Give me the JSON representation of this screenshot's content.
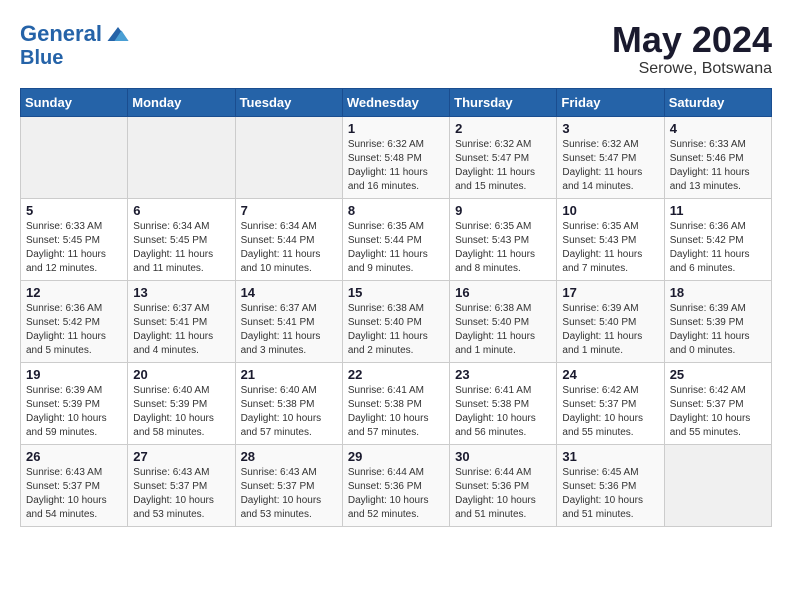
{
  "header": {
    "logo_line1": "General",
    "logo_line2": "Blue",
    "month": "May 2024",
    "location": "Serowe, Botswana"
  },
  "weekdays": [
    "Sunday",
    "Monday",
    "Tuesday",
    "Wednesday",
    "Thursday",
    "Friday",
    "Saturday"
  ],
  "weeks": [
    [
      {
        "day": "",
        "info": ""
      },
      {
        "day": "",
        "info": ""
      },
      {
        "day": "",
        "info": ""
      },
      {
        "day": "1",
        "info": "Sunrise: 6:32 AM\nSunset: 5:48 PM\nDaylight: 11 hours\nand 16 minutes."
      },
      {
        "day": "2",
        "info": "Sunrise: 6:32 AM\nSunset: 5:47 PM\nDaylight: 11 hours\nand 15 minutes."
      },
      {
        "day": "3",
        "info": "Sunrise: 6:32 AM\nSunset: 5:47 PM\nDaylight: 11 hours\nand 14 minutes."
      },
      {
        "day": "4",
        "info": "Sunrise: 6:33 AM\nSunset: 5:46 PM\nDaylight: 11 hours\nand 13 minutes."
      }
    ],
    [
      {
        "day": "5",
        "info": "Sunrise: 6:33 AM\nSunset: 5:45 PM\nDaylight: 11 hours\nand 12 minutes."
      },
      {
        "day": "6",
        "info": "Sunrise: 6:34 AM\nSunset: 5:45 PM\nDaylight: 11 hours\nand 11 minutes."
      },
      {
        "day": "7",
        "info": "Sunrise: 6:34 AM\nSunset: 5:44 PM\nDaylight: 11 hours\nand 10 minutes."
      },
      {
        "day": "8",
        "info": "Sunrise: 6:35 AM\nSunset: 5:44 PM\nDaylight: 11 hours\nand 9 minutes."
      },
      {
        "day": "9",
        "info": "Sunrise: 6:35 AM\nSunset: 5:43 PM\nDaylight: 11 hours\nand 8 minutes."
      },
      {
        "day": "10",
        "info": "Sunrise: 6:35 AM\nSunset: 5:43 PM\nDaylight: 11 hours\nand 7 minutes."
      },
      {
        "day": "11",
        "info": "Sunrise: 6:36 AM\nSunset: 5:42 PM\nDaylight: 11 hours\nand 6 minutes."
      }
    ],
    [
      {
        "day": "12",
        "info": "Sunrise: 6:36 AM\nSunset: 5:42 PM\nDaylight: 11 hours\nand 5 minutes."
      },
      {
        "day": "13",
        "info": "Sunrise: 6:37 AM\nSunset: 5:41 PM\nDaylight: 11 hours\nand 4 minutes."
      },
      {
        "day": "14",
        "info": "Sunrise: 6:37 AM\nSunset: 5:41 PM\nDaylight: 11 hours\nand 3 minutes."
      },
      {
        "day": "15",
        "info": "Sunrise: 6:38 AM\nSunset: 5:40 PM\nDaylight: 11 hours\nand 2 minutes."
      },
      {
        "day": "16",
        "info": "Sunrise: 6:38 AM\nSunset: 5:40 PM\nDaylight: 11 hours\nand 1 minute."
      },
      {
        "day": "17",
        "info": "Sunrise: 6:39 AM\nSunset: 5:40 PM\nDaylight: 11 hours\nand 1 minute."
      },
      {
        "day": "18",
        "info": "Sunrise: 6:39 AM\nSunset: 5:39 PM\nDaylight: 11 hours\nand 0 minutes."
      }
    ],
    [
      {
        "day": "19",
        "info": "Sunrise: 6:39 AM\nSunset: 5:39 PM\nDaylight: 10 hours\nand 59 minutes."
      },
      {
        "day": "20",
        "info": "Sunrise: 6:40 AM\nSunset: 5:39 PM\nDaylight: 10 hours\nand 58 minutes."
      },
      {
        "day": "21",
        "info": "Sunrise: 6:40 AM\nSunset: 5:38 PM\nDaylight: 10 hours\nand 57 minutes."
      },
      {
        "day": "22",
        "info": "Sunrise: 6:41 AM\nSunset: 5:38 PM\nDaylight: 10 hours\nand 57 minutes."
      },
      {
        "day": "23",
        "info": "Sunrise: 6:41 AM\nSunset: 5:38 PM\nDaylight: 10 hours\nand 56 minutes."
      },
      {
        "day": "24",
        "info": "Sunrise: 6:42 AM\nSunset: 5:37 PM\nDaylight: 10 hours\nand 55 minutes."
      },
      {
        "day": "25",
        "info": "Sunrise: 6:42 AM\nSunset: 5:37 PM\nDaylight: 10 hours\nand 55 minutes."
      }
    ],
    [
      {
        "day": "26",
        "info": "Sunrise: 6:43 AM\nSunset: 5:37 PM\nDaylight: 10 hours\nand 54 minutes."
      },
      {
        "day": "27",
        "info": "Sunrise: 6:43 AM\nSunset: 5:37 PM\nDaylight: 10 hours\nand 53 minutes."
      },
      {
        "day": "28",
        "info": "Sunrise: 6:43 AM\nSunset: 5:37 PM\nDaylight: 10 hours\nand 53 minutes."
      },
      {
        "day": "29",
        "info": "Sunrise: 6:44 AM\nSunset: 5:36 PM\nDaylight: 10 hours\nand 52 minutes."
      },
      {
        "day": "30",
        "info": "Sunrise: 6:44 AM\nSunset: 5:36 PM\nDaylight: 10 hours\nand 51 minutes."
      },
      {
        "day": "31",
        "info": "Sunrise: 6:45 AM\nSunset: 5:36 PM\nDaylight: 10 hours\nand 51 minutes."
      },
      {
        "day": "",
        "info": ""
      }
    ]
  ]
}
